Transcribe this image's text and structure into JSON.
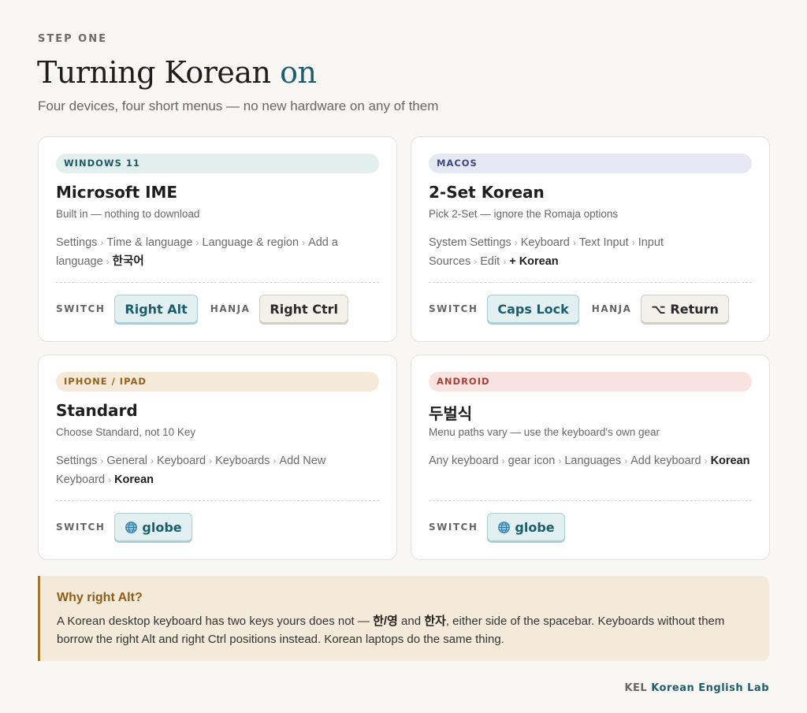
{
  "header": {
    "eyebrow": "STEP ONE",
    "title_main": "Turning Korean",
    "title_accent": "on",
    "subtitle": "Four devices, four short menus — no new hardware on any of them"
  },
  "cards": [
    {
      "tag": "WINDOWS 11",
      "title": "Microsoft IME",
      "subtitle": "Built in — nothing to download",
      "path": [
        "Settings",
        "Time & language",
        "Language & region",
        "Add a language",
        "한국어"
      ],
      "switch_label": "SWITCH",
      "switch_key": "Right Alt",
      "hanja_label": "HANJA",
      "hanja_key": "Right Ctrl"
    },
    {
      "tag": "MACOS",
      "title": "2-Set Korean",
      "subtitle": "Pick 2-Set — ignore the Romaja options",
      "path": [
        "System Settings",
        "Keyboard",
        "Text Input",
        "Input Sources",
        "Edit",
        "+ Korean"
      ],
      "switch_label": "SWITCH",
      "switch_key": "Caps Lock",
      "hanja_label": "HANJA",
      "hanja_key": "⌥ Return"
    },
    {
      "tag": "IPHONE / IPAD",
      "title": "Standard",
      "subtitle": "Choose Standard, not 10 Key",
      "path": [
        "Settings",
        "General",
        "Keyboard",
        "Keyboards",
        "Add New Keyboard",
        "Korean"
      ],
      "switch_label": "SWITCH",
      "switch_key": "globe",
      "switch_icon": "globe-icon"
    },
    {
      "tag": "ANDROID",
      "title": "두벌식",
      "subtitle": "Menu paths vary — use the keyboard's own gear",
      "path": [
        "Any keyboard",
        "gear icon",
        "Languages",
        "Add keyboard",
        "Korean"
      ],
      "switch_label": "SWITCH",
      "switch_key": "globe",
      "switch_icon": "globe-icon"
    }
  ],
  "callout": {
    "title": "Why right Alt?",
    "body_1": "A Korean desktop keyboard has two keys yours does not — ",
    "key_1": "한/영",
    "body_2": " and ",
    "key_2": "한자",
    "body_3": ", either side of the spacebar. Keyboards without them borrow the right Alt and right Ctrl positions instead. Korean laptops do the same thing."
  },
  "footer": {
    "brand_short": "KEL",
    "brand_name": "Korean English Lab"
  },
  "colors": {
    "background": "#f8f7f4",
    "accent": "#1d5e6d",
    "callout_bg": "#f4ead9",
    "callout_border": "#a4752e"
  }
}
